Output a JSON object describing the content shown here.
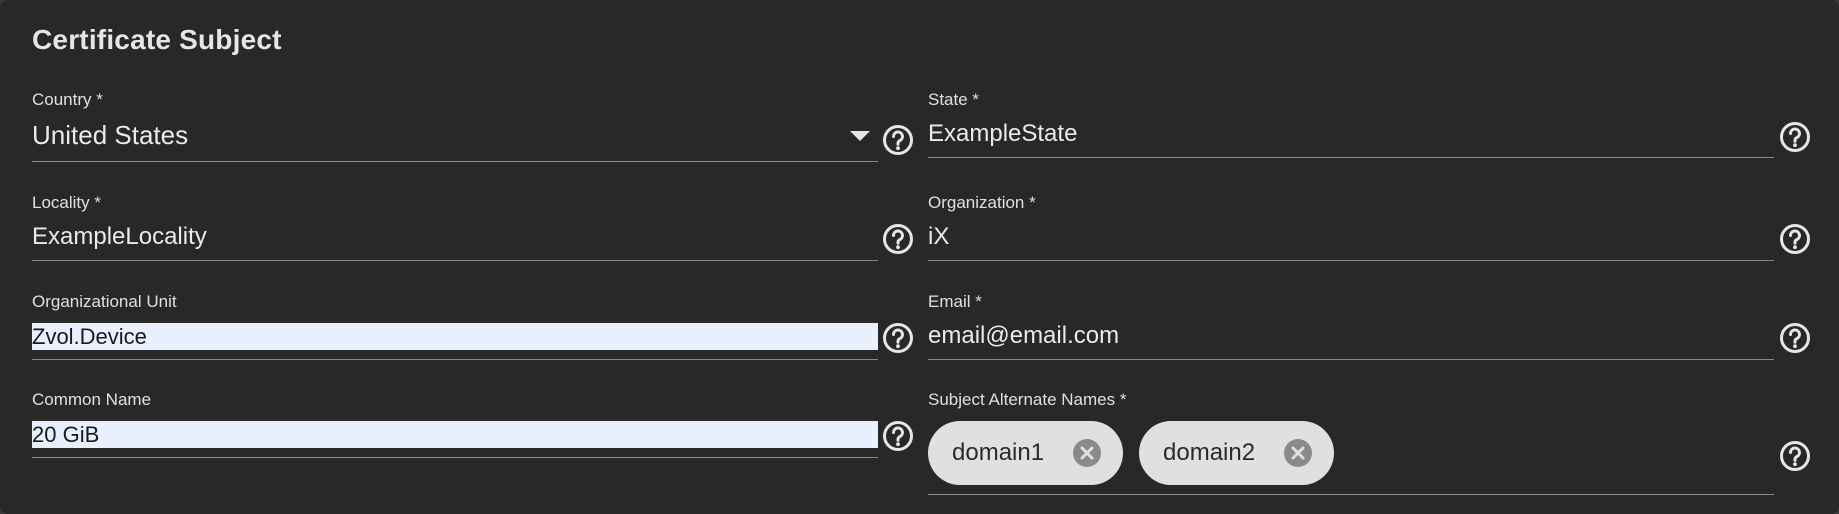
{
  "section": {
    "title": "Certificate Subject"
  },
  "fields": {
    "country": {
      "label": "Country *",
      "value": "United States"
    },
    "state": {
      "label": "State *",
      "value": "ExampleState"
    },
    "locality": {
      "label": "Locality *",
      "value": "ExampleLocality"
    },
    "organization": {
      "label": "Organization *",
      "value": "iX"
    },
    "organizational_unit": {
      "label": "Organizational Unit",
      "value": "Zvol.Device"
    },
    "email": {
      "label": "Email *",
      "value": "email@email.com"
    },
    "common_name": {
      "label": "Common Name",
      "value": "20 GiB"
    },
    "san": {
      "label": "Subject Alternate Names *",
      "chips": [
        "domain1",
        "domain2"
      ]
    }
  },
  "icons": {
    "help": "help-circle-icon",
    "chip_remove": "cancel-circle-icon",
    "dropdown": "triangle-down-icon"
  },
  "colors": {
    "background": "#282828",
    "text": "#eaeaea",
    "underline": "#8a8a8a",
    "autofill": "#e8f0fe",
    "chip": "#e0e0e0",
    "chip_remove": "#8a8a8a"
  }
}
